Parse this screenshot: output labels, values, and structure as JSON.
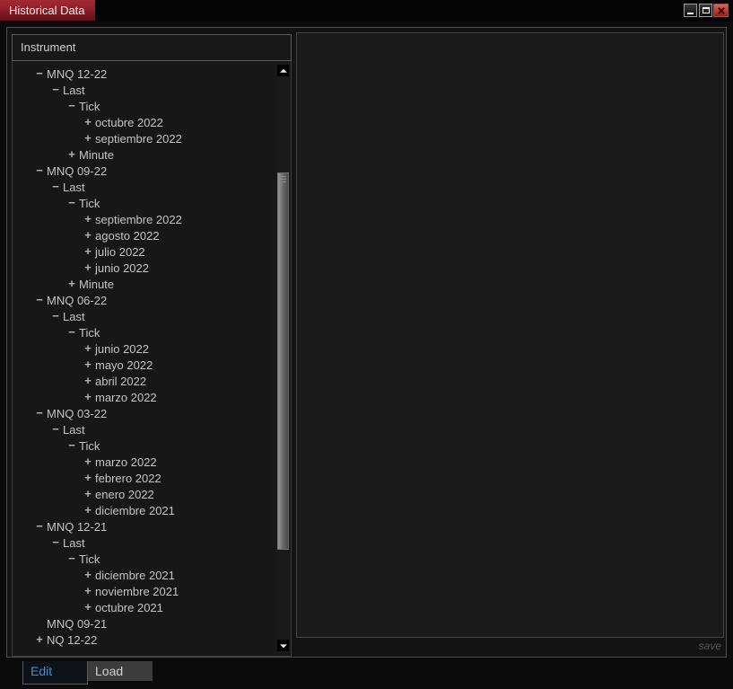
{
  "window": {
    "title": "Historical Data",
    "controls": {
      "minimize": "minimize",
      "maximize": "maximize",
      "close": "close"
    }
  },
  "left_panel": {
    "header": "Instrument",
    "expander_glyphs": {
      "expanded": "−",
      "collapsed": "+"
    },
    "tree": [
      {
        "label": "MNQ 12-22",
        "level": 0,
        "expander": "expanded"
      },
      {
        "label": "Last",
        "level": 1,
        "expander": "expanded"
      },
      {
        "label": "Tick",
        "level": 2,
        "expander": "expanded"
      },
      {
        "label": "octubre 2022",
        "level": 3,
        "expander": "collapsed"
      },
      {
        "label": "septiembre 2022",
        "level": 3,
        "expander": "collapsed"
      },
      {
        "label": "Minute",
        "level": 2,
        "expander": "collapsed"
      },
      {
        "label": "MNQ 09-22",
        "level": 0,
        "expander": "expanded"
      },
      {
        "label": "Last",
        "level": 1,
        "expander": "expanded"
      },
      {
        "label": "Tick",
        "level": 2,
        "expander": "expanded"
      },
      {
        "label": "septiembre 2022",
        "level": 3,
        "expander": "collapsed"
      },
      {
        "label": "agosto 2022",
        "level": 3,
        "expander": "collapsed"
      },
      {
        "label": "julio 2022",
        "level": 3,
        "expander": "collapsed"
      },
      {
        "label": "junio 2022",
        "level": 3,
        "expander": "collapsed"
      },
      {
        "label": "Minute",
        "level": 2,
        "expander": "collapsed"
      },
      {
        "label": "MNQ 06-22",
        "level": 0,
        "expander": "expanded"
      },
      {
        "label": "Last",
        "level": 1,
        "expander": "expanded"
      },
      {
        "label": "Tick",
        "level": 2,
        "expander": "expanded"
      },
      {
        "label": "junio 2022",
        "level": 3,
        "expander": "collapsed"
      },
      {
        "label": "mayo 2022",
        "level": 3,
        "expander": "collapsed"
      },
      {
        "label": "abril 2022",
        "level": 3,
        "expander": "collapsed"
      },
      {
        "label": "marzo 2022",
        "level": 3,
        "expander": "collapsed"
      },
      {
        "label": "MNQ 03-22",
        "level": 0,
        "expander": "expanded"
      },
      {
        "label": "Last",
        "level": 1,
        "expander": "expanded"
      },
      {
        "label": "Tick",
        "level": 2,
        "expander": "expanded"
      },
      {
        "label": "marzo 2022",
        "level": 3,
        "expander": "collapsed"
      },
      {
        "label": "febrero 2022",
        "level": 3,
        "expander": "collapsed"
      },
      {
        "label": "enero 2022",
        "level": 3,
        "expander": "collapsed"
      },
      {
        "label": "diciembre 2021",
        "level": 3,
        "expander": "collapsed"
      },
      {
        "label": "MNQ 12-21",
        "level": 0,
        "expander": "expanded"
      },
      {
        "label": "Last",
        "level": 1,
        "expander": "expanded"
      },
      {
        "label": "Tick",
        "level": 2,
        "expander": "expanded"
      },
      {
        "label": "diciembre 2021",
        "level": 3,
        "expander": "collapsed"
      },
      {
        "label": "noviembre 2021",
        "level": 3,
        "expander": "collapsed"
      },
      {
        "label": "octubre 2021",
        "level": 3,
        "expander": "collapsed"
      },
      {
        "label": "MNQ 09-21",
        "level": 0,
        "expander": "none"
      },
      {
        "label": "NQ 12-22",
        "level": 0,
        "expander": "collapsed"
      }
    ]
  },
  "right_panel": {
    "save_label": "save"
  },
  "tabs": [
    {
      "label": "Edit",
      "active": true
    },
    {
      "label": "Load",
      "active": false
    }
  ],
  "colors": {
    "title_tab_red": "#8e1e27",
    "close_button_red": "#991d14",
    "active_tab_blue": "#4090d8",
    "tree_text": "#c4c4c4",
    "panel_background": "#1a1a1a"
  }
}
